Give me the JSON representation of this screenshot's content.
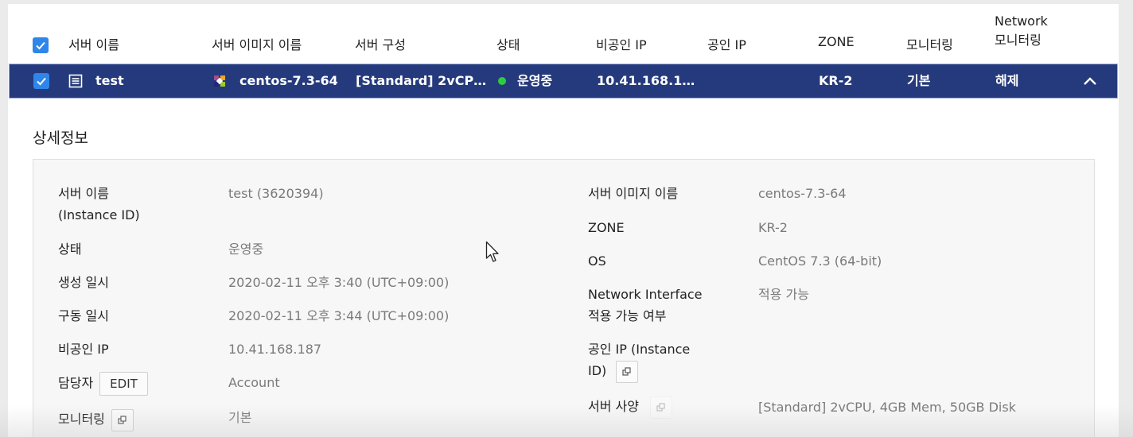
{
  "table": {
    "headers": {
      "server_name": "서버 이름",
      "server_image": "서버 이미지 이름",
      "server_spec": "서버 구성",
      "status": "상태",
      "private_ip": "비공인 IP",
      "public_ip": "공인 IP",
      "zone": "ZONE",
      "monitoring": "모니터링",
      "net_monitoring_line1": "Network",
      "net_monitoring_line2": "모니터링"
    },
    "selected_row": {
      "server_name": "test",
      "server_image": "centos-7.3-64",
      "server_spec": "[Standard] 2vCP…",
      "status": "운영중",
      "private_ip": "10.41.168.1…",
      "public_ip": "",
      "zone": "KR-2",
      "monitoring": "기본",
      "net_monitoring": "해제"
    }
  },
  "detail": {
    "title": "상세정보",
    "left": {
      "server_name_label_1": "서버 이름",
      "server_name_label_2": "(Instance ID)",
      "server_name_value": "test (3620394)",
      "status_label": "상태",
      "status_value": "운영중",
      "created_label": "생성 일시",
      "created_value": "2020-02-11 오후 3:40 (UTC+09:00)",
      "started_label": "구동 일시",
      "started_value": "2020-02-11 오후 3:44 (UTC+09:00)",
      "private_ip_label": "비공인 IP",
      "private_ip_value": "10.41.168.187",
      "owner_label": "담당자",
      "edit_button": "EDIT",
      "owner_value": "Account",
      "monitoring_label": "모니터링",
      "monitoring_value": "기본"
    },
    "right": {
      "image_label": "서버 이미지 이름",
      "image_value": "centos-7.3-64",
      "zone_label": "ZONE",
      "zone_value": "KR-2",
      "os_label": "OS",
      "os_value": "CentOS 7.3 (64-bit)",
      "ni_label_1": "Network Interface",
      "ni_label_2": "적용 가능 여부",
      "ni_value": "적용 가능",
      "public_ip_label_1": "공인 IP (Instance",
      "public_ip_label_2": "ID)",
      "spec_label": "서버 사양",
      "spec_value": "[Standard] 2vCPU, 4GB Mem, 50GB Disk"
    }
  },
  "colors": {
    "selected_row_bg": "#253a7c",
    "checkbox": "#2f86ea",
    "status_running": "#2ecc40"
  },
  "icons": [
    "checkbox-checked-icon",
    "server-icon",
    "centos-logo-icon",
    "status-dot-icon",
    "chevron-up-icon",
    "copy-icon",
    "mouse-cursor-icon"
  ]
}
